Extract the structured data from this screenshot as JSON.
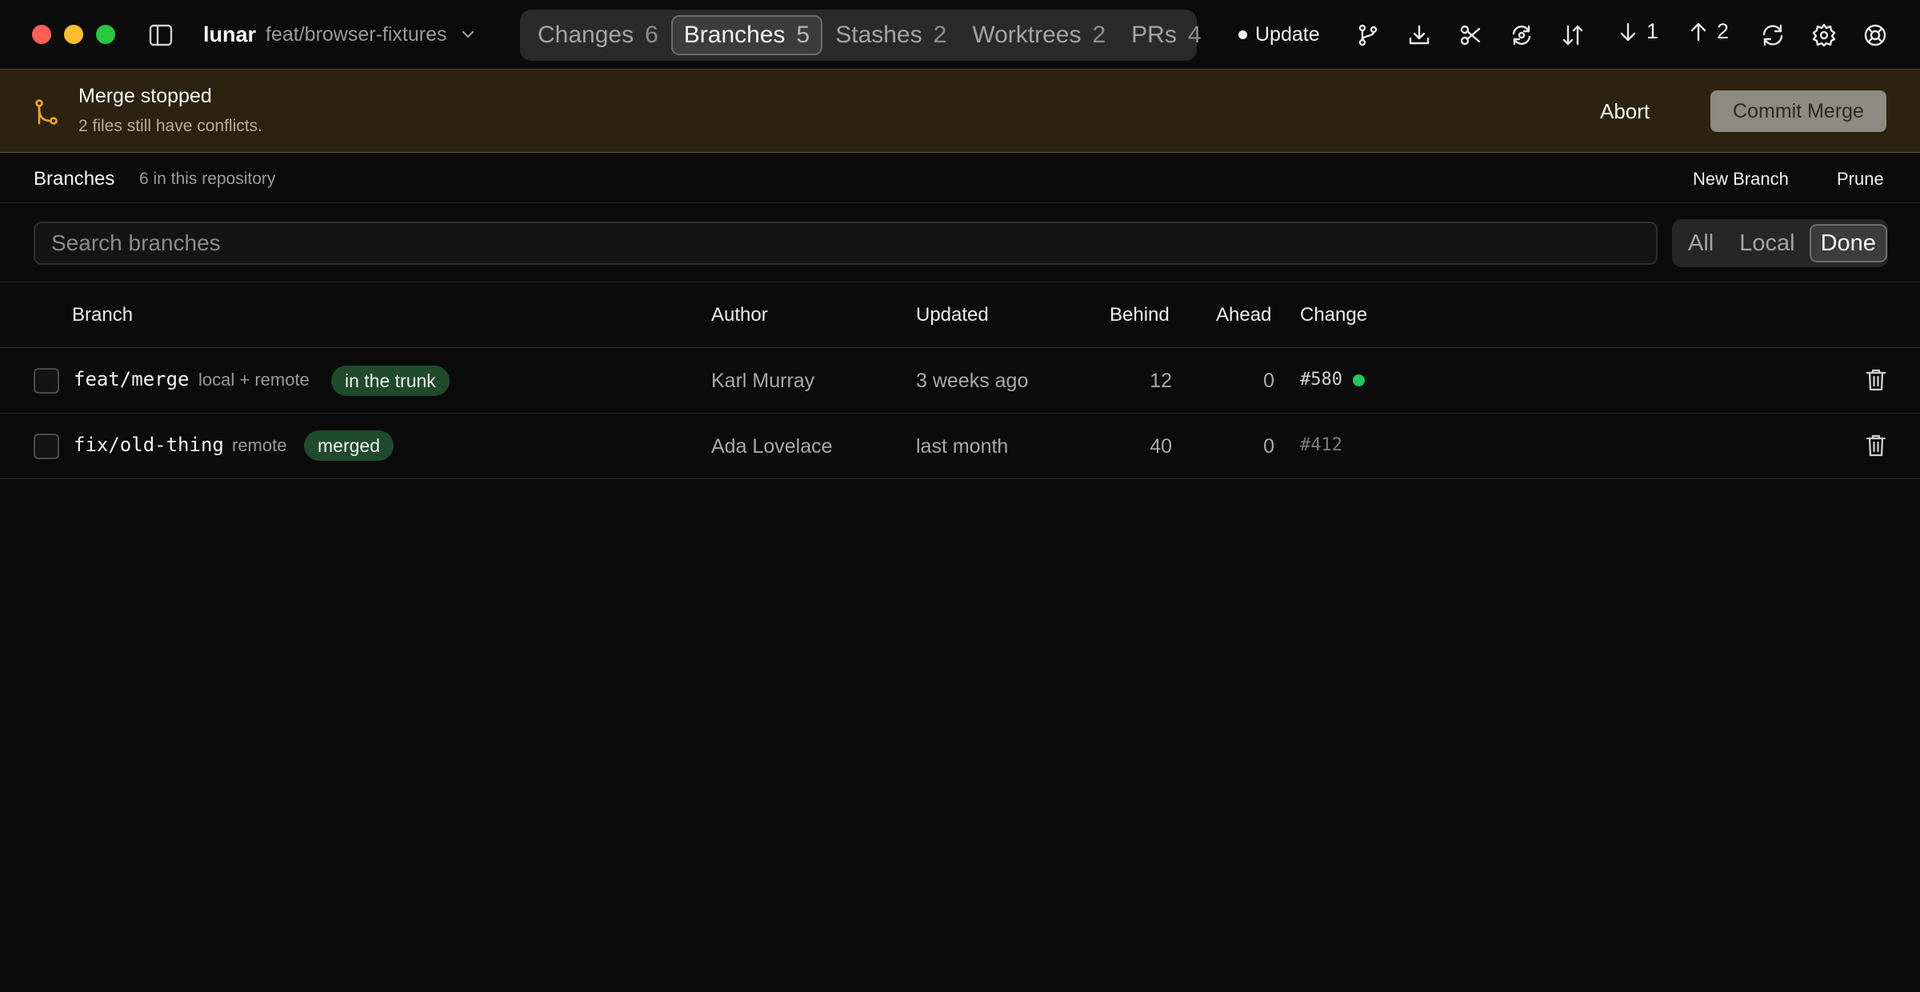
{
  "window": {
    "repo_name": "lunar",
    "current_branch": "feat/browser-fixtures"
  },
  "tabs": [
    {
      "label": "Changes",
      "count": "6"
    },
    {
      "label": "Branches",
      "count": "5",
      "active": true
    },
    {
      "label": "Stashes",
      "count": "2"
    },
    {
      "label": "Worktrees",
      "count": "2"
    },
    {
      "label": "PRs",
      "count": "4"
    }
  ],
  "toolbar": {
    "update_label": "Update",
    "pull_count": "1",
    "push_count": "2",
    "icons": [
      "branch-fork-icon",
      "download-icon",
      "scissors-icon",
      "refresh-history-icon",
      "swap-arrows-icon",
      "arrow-down-icon",
      "arrow-up-icon",
      "sync-icon",
      "gear-icon",
      "help-lifebuoy-icon"
    ]
  },
  "banner": {
    "title": "Merge stopped",
    "subtitle": "2 files still have conflicts.",
    "abort_label": "Abort",
    "commit_label": "Commit Merge",
    "accent_color": "#f5a524"
  },
  "section": {
    "title": "Branches",
    "count_text": "6 in this repository",
    "new_branch_label": "New Branch",
    "prune_label": "Prune"
  },
  "search": {
    "placeholder": "Search branches"
  },
  "filter": {
    "options": [
      "All",
      "Local",
      "Done"
    ],
    "selected": "Done"
  },
  "table": {
    "columns": {
      "branch": "Branch",
      "author": "Author",
      "updated": "Updated",
      "behind": "Behind",
      "ahead": "Ahead",
      "change": "Change"
    },
    "rows": [
      {
        "name": "feat/merge",
        "location": "local + remote",
        "badge": "in the trunk",
        "author": "Karl Murray",
        "updated": "3 weeks ago",
        "behind": "12",
        "ahead": "0",
        "change": "#580",
        "change_status_color": "#22c55e"
      },
      {
        "name": "fix/old-thing",
        "location": "remote",
        "badge": "merged",
        "author": "Ada Lovelace",
        "updated": "last month",
        "behind": "40",
        "ahead": "0",
        "change": "#412"
      }
    ]
  }
}
